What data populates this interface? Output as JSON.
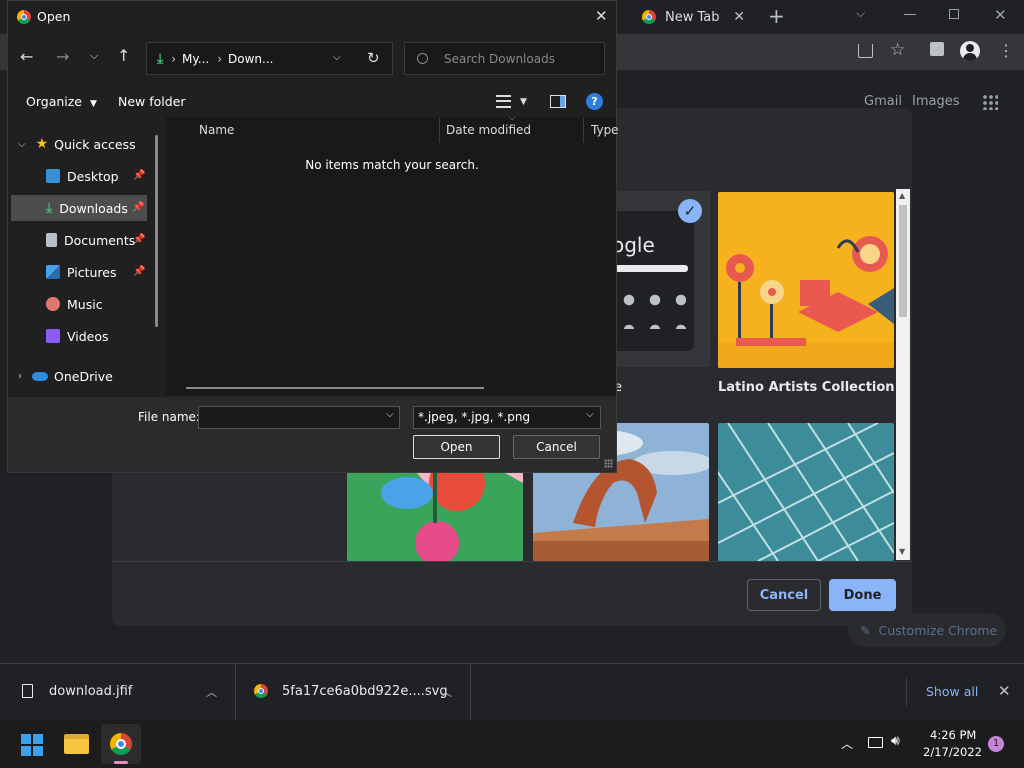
{
  "chrome": {
    "tab_label": "New Tab",
    "new_tab_symbol": "+",
    "links": {
      "gmail": "Gmail",
      "images": "Images"
    },
    "customize_label": "Customize Chrome"
  },
  "customize_modal": {
    "tiles": [
      {
        "caption": "Latino Artists Collection"
      }
    ],
    "partial_logo_text": "ogle",
    "partial_caption": "e",
    "cancel_label": "Cancel",
    "done_label": "Done",
    "accent_color": "#8ab4f8"
  },
  "open_dialog": {
    "title": "Open",
    "breadcrumb": [
      "My...",
      "Down..."
    ],
    "breadcrumb_sep": "›",
    "search_placeholder": "Search Downloads",
    "organize_label": "Organize",
    "new_folder_label": "New folder",
    "help_symbol": "?",
    "sidebar": [
      {
        "label": "Quick access",
        "icon": "star-icon",
        "pinned": false
      },
      {
        "label": "Desktop",
        "icon": "desktop-icon",
        "pinned": true
      },
      {
        "label": "Downloads",
        "icon": "download-icon",
        "pinned": true,
        "selected": true
      },
      {
        "label": "Documents",
        "icon": "document-icon",
        "pinned": true
      },
      {
        "label": "Pictures",
        "icon": "pictures-icon",
        "pinned": true
      },
      {
        "label": "Music",
        "icon": "music-icon",
        "pinned": false
      },
      {
        "label": "Videos",
        "icon": "videos-icon",
        "pinned": false
      },
      {
        "label": "OneDrive",
        "icon": "cloud-icon",
        "pinned": false
      }
    ],
    "columns": [
      "Name",
      "Date modified",
      "Type"
    ],
    "empty_message": "No items match your search.",
    "filename_label": "File name:",
    "filename_value": "",
    "filter_value": "*.jpeg, *.jpg, *.png",
    "open_label": "Open",
    "cancel_label": "Cancel"
  },
  "downloads_bar": {
    "items": [
      {
        "name": "download.jfif"
      },
      {
        "name": "5fa17ce6a0bd922e....svg"
      }
    ],
    "show_all_label": "Show all"
  },
  "taskbar": {
    "time": "4:26 PM",
    "date": "2/17/2022",
    "notification_count": "1"
  }
}
